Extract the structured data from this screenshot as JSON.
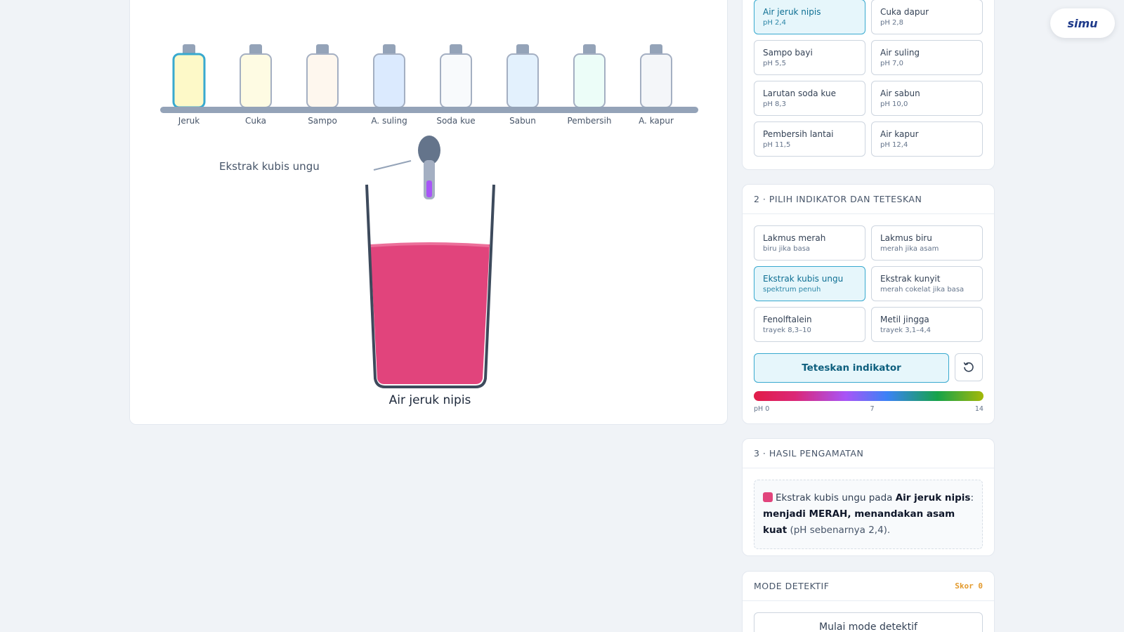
{
  "colors": {
    "accent": "#38a9cf",
    "liquid": "#e1447c",
    "swatch": "#e1447c",
    "score": "#e39a2d"
  },
  "logo": {
    "text": "simu"
  },
  "stage": {
    "indicator_label": "Ekstrak kubis ungu",
    "sample_label": "Air jeruk nipis",
    "bottles": [
      {
        "label": "Jeruk",
        "color": "#fdf9c8",
        "selected": true
      },
      {
        "label": "Cuka",
        "color": "#fefbe3",
        "selected": false
      },
      {
        "label": "Sampo",
        "color": "#fef7ee",
        "selected": false
      },
      {
        "label": "A. suling",
        "color": "#dbeafe",
        "selected": false
      },
      {
        "label": "Soda kue",
        "color": "#f8fafc",
        "selected": false
      },
      {
        "label": "Sabun",
        "color": "#e3f1fd",
        "selected": false
      },
      {
        "label": "Pembersih",
        "color": "#ecfdf8",
        "selected": false
      },
      {
        "label": "A. kapur",
        "color": "#f4f6f9",
        "selected": false
      }
    ]
  },
  "samples": [
    {
      "title": "Air jeruk nipis",
      "sub": "pH 2,4"
    },
    {
      "title": "Cuka dapur",
      "sub": "pH 2,8"
    },
    {
      "title": "Sampo bayi",
      "sub": "pH 5,5"
    },
    {
      "title": "Air suling",
      "sub": "pH 7,0"
    },
    {
      "title": "Larutan soda kue",
      "sub": "pH 8,3"
    },
    {
      "title": "Air sabun",
      "sub": "pH 10,0"
    },
    {
      "title": "Pembersih lantai",
      "sub": "pH 11,5"
    },
    {
      "title": "Air kapur",
      "sub": "pH 12,4"
    }
  ],
  "indicator_panel": {
    "title": "2 · PILIH INDIKATOR DAN TETESKAN",
    "options": [
      {
        "title": "Lakmus merah",
        "sub": "biru jika basa"
      },
      {
        "title": "Lakmus biru",
        "sub": "merah jika asam"
      },
      {
        "title": "Ekstrak kubis ungu",
        "sub": "spektrum penuh"
      },
      {
        "title": "Ekstrak kunyit",
        "sub": "merah cokelat jika basa"
      },
      {
        "title": "Fenolftalein",
        "sub": "trayek 8,3–10"
      },
      {
        "title": "Metil jingga",
        "sub": "trayek 3,1–4,4"
      }
    ],
    "drop_button": "Teteskan indikator",
    "scale": {
      "min_label": "pH 0",
      "mid_label": "7",
      "max_label": "14"
    }
  },
  "result_panel": {
    "title": "3 · HASIL PENGAMATAN",
    "part1": "Ekstrak kubis ungu pada ",
    "sample": "Air jeruk nipis",
    "colon": ":",
    "verdict": "menjadi MERAH, menandakan asam kuat",
    "part2": " (pH sebenarnya 2,4)."
  },
  "detective_panel": {
    "title": "MODE DETEKTIF",
    "score": "Skor 0",
    "button": "Mulai mode detektif"
  }
}
